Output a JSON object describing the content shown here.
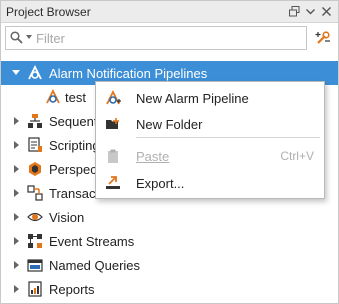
{
  "panel": {
    "title": "Project Browser"
  },
  "filter": {
    "placeholder": "Filter"
  },
  "tree": {
    "root": {
      "label": "Alarm Notification Pipelines",
      "expanded": true,
      "selected": true
    },
    "child": {
      "label": "test"
    },
    "items": [
      {
        "label": "Sequent"
      },
      {
        "label": "Scripting"
      },
      {
        "label": "Perspect"
      },
      {
        "label": "Transact"
      },
      {
        "label": "Vision"
      },
      {
        "label": "Event Streams"
      },
      {
        "label": "Named Queries"
      },
      {
        "label": "Reports"
      }
    ]
  },
  "context_menu": {
    "items": [
      {
        "label": "New Alarm Pipeline",
        "enabled": true
      },
      {
        "label": "New Folder",
        "enabled": true
      },
      {
        "label": "Paste",
        "enabled": false,
        "shortcut": "Ctrl+V"
      },
      {
        "label": "Export...",
        "enabled": true
      }
    ]
  },
  "colors": {
    "selection": "#3c8ed6",
    "accent_orange": "#e2761b",
    "icon_blue": "#2a6cb5"
  }
}
